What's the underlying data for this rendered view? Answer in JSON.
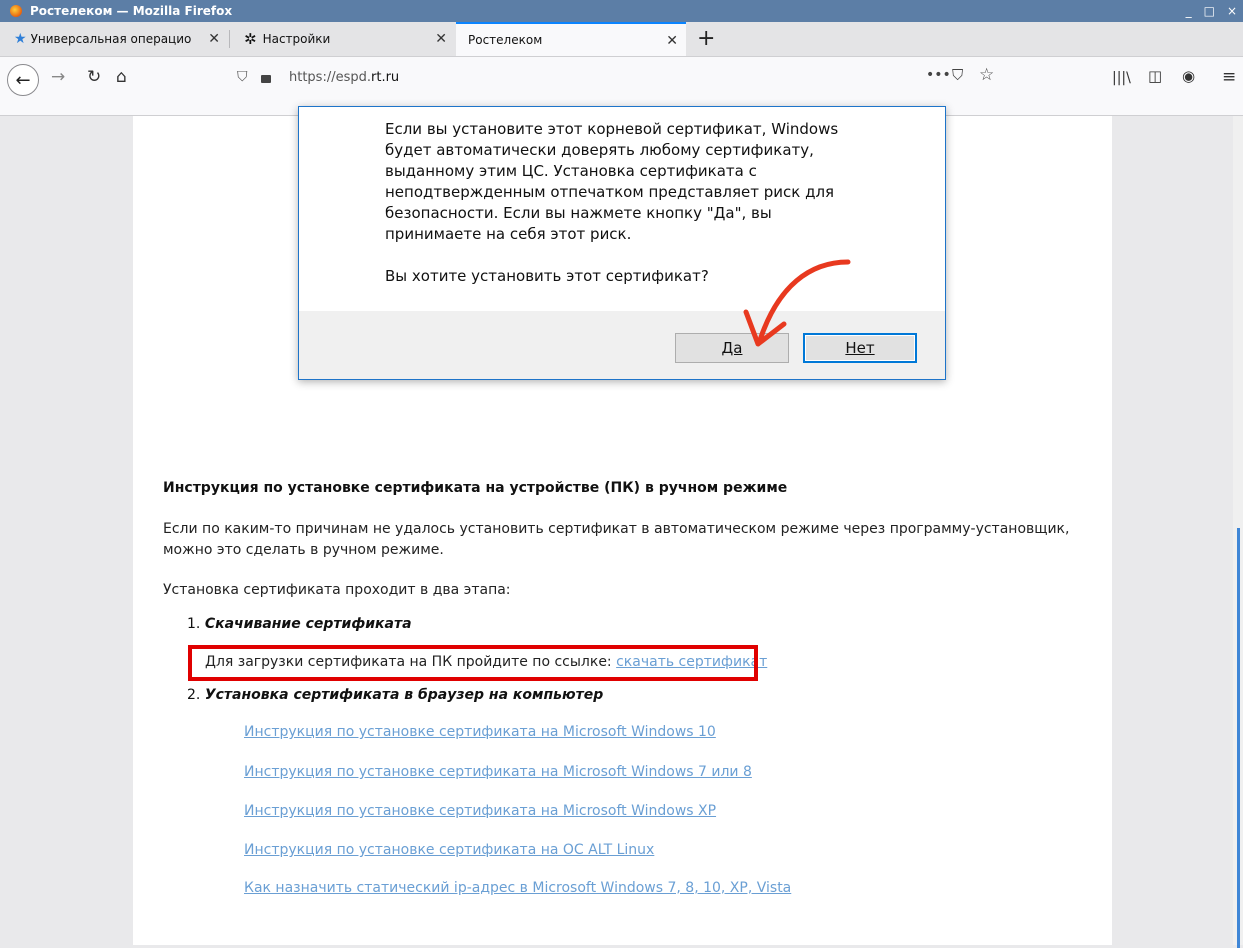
{
  "window": {
    "title": "Ростелеком — Mozilla Firefox"
  },
  "tabs": [
    {
      "label": "Универсальная операцио"
    },
    {
      "label": "Настройки"
    },
    {
      "label": "Ростелеком"
    }
  ],
  "url": {
    "prefix": "https://espd.",
    "domain": "rt.ru"
  },
  "dialog": {
    "text_lines": [
      "Если вы установите этот корневой сертификат, Windows",
      "будет автоматически доверять любому сертификату,",
      "выданному этим ЦС. Установка сертификата с",
      "неподтвержденным отпечатком представляет риск для",
      "безопасности. Если вы нажмете кнопку \"Да\", вы",
      "принимаете на себя этот риск."
    ],
    "question": "Вы хотите установить этот сертификат?",
    "yes_label": "Да",
    "no_label": "Нет"
  },
  "article": {
    "heading": "Инструкция по установке сертификата на устройстве (ПК) в ручном режиме",
    "intro_line1": "Если по каким-то причинам не удалось установить сертификат в автоматическом режиме через программу-установщик,",
    "intro_line2": "можно это сделать в ручном режиме.",
    "stages": "Установка сертификата проходит в два этапа:",
    "step1_num": "1.",
    "step1_title": "Скачивание сертификата",
    "download_text": "Для загрузки сертификата на ПК пройдите по ссылке:",
    "download_link": "скачать сертификат",
    "step2_num": "2.",
    "step2_title": "Установка сертификата в браузер на компьютер",
    "links": [
      "Инструкция по установке сертификата на Microsoft Windows 10",
      "Инструкция по установке сертификата на Microsoft Windows 7 или 8",
      "Инструкция по установке сертификата на Microsoft Windows XP",
      "Инструкция по установке сертификата на ОС ALT Linux",
      "Как назначить статический ip-адрес в Microsoft Windows 7, 8, 10, XP, Vista"
    ]
  },
  "colors": {
    "accent": "#0a84ff",
    "link": "#6a9fd4",
    "highlight": "#e00000",
    "arrow": "#e8391f"
  }
}
